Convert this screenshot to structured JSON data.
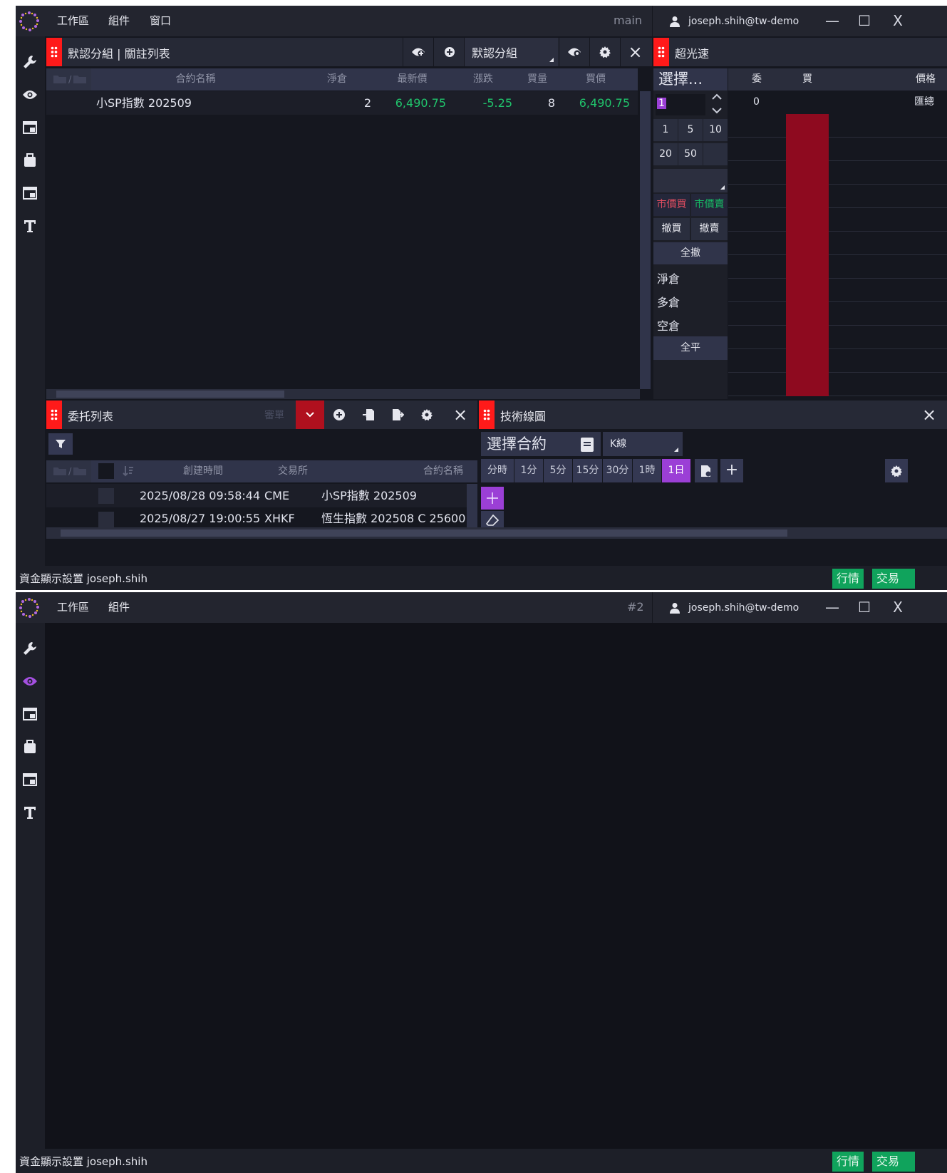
{
  "window1": {
    "menu": [
      "工作區",
      "組件",
      "窗口"
    ],
    "title": "main",
    "user": "joseph.shih@tw-demo",
    "controls": {
      "minimize": "—",
      "maximize": "☐",
      "close": "X"
    }
  },
  "window2": {
    "menu": [
      "工作區",
      "組件"
    ],
    "title": "#2",
    "user": "joseph.shih@tw-demo",
    "controls": {
      "minimize": "—",
      "maximize": "☐",
      "close": "X"
    }
  },
  "watchlist": {
    "title": "默認分組 | 關註列表",
    "group_select": "默認分組",
    "headers": [
      "合約名稱",
      "淨倉",
      "最新價",
      "漲跌",
      "買量",
      "買價"
    ],
    "rows": [
      {
        "name": "小SP指數 202509",
        "net": "2",
        "last": "6,490.75",
        "change": "-5.25",
        "bidqty": "8",
        "bid": "6,490.75"
      }
    ],
    "close": "×"
  },
  "dom": {
    "title": "超光速",
    "select": "選擇...",
    "qty_value": "1",
    "headers": [
      "委",
      "買",
      "價格"
    ],
    "summary_row": {
      "order": "0",
      "price": "匯總"
    },
    "quick_qty": [
      "1",
      "5",
      "10",
      "20",
      "50"
    ],
    "market_buy": "市價買",
    "market_sell": "市價賣",
    "cancel_buy": "撤買",
    "cancel_sell": "撤賣",
    "cancel_all": "全撤",
    "net_pos": "淨倉",
    "long_pos": "多倉",
    "short_pos": "空倉",
    "flatten_all": "全平",
    "colors": {
      "bid_column": "#8e0a1f"
    }
  },
  "orders": {
    "title": "委托列表",
    "send_label": "審單",
    "headers": [
      "創建時間",
      "交易所",
      "合約名稱"
    ],
    "rows": [
      {
        "time": "2025/08/28 09:58:44",
        "exchange": "CME",
        "name": "小SP指數 202509"
      },
      {
        "time": "2025/08/27 19:00:55",
        "exchange": "XHKF",
        "name": "恆生指數 202508 C 25600"
      }
    ],
    "close": "×"
  },
  "chart": {
    "title": "技術線圖",
    "select_contract": "選擇合約",
    "chart_type": "K線",
    "timeframes": [
      "分時",
      "1分",
      "5分",
      "15分",
      "30分",
      "1時",
      "1日"
    ],
    "active_timeframe": "1日",
    "add": "+",
    "close": "×"
  },
  "status": {
    "text": "資金顯示設置 joseph.shih",
    "market_btn": "行情",
    "trade_btn": "交易"
  },
  "colors": {
    "grip": "#ff1a1a",
    "accent": "#9b3fd6",
    "green": "#20c56c",
    "red_btn": "#b0101e"
  }
}
